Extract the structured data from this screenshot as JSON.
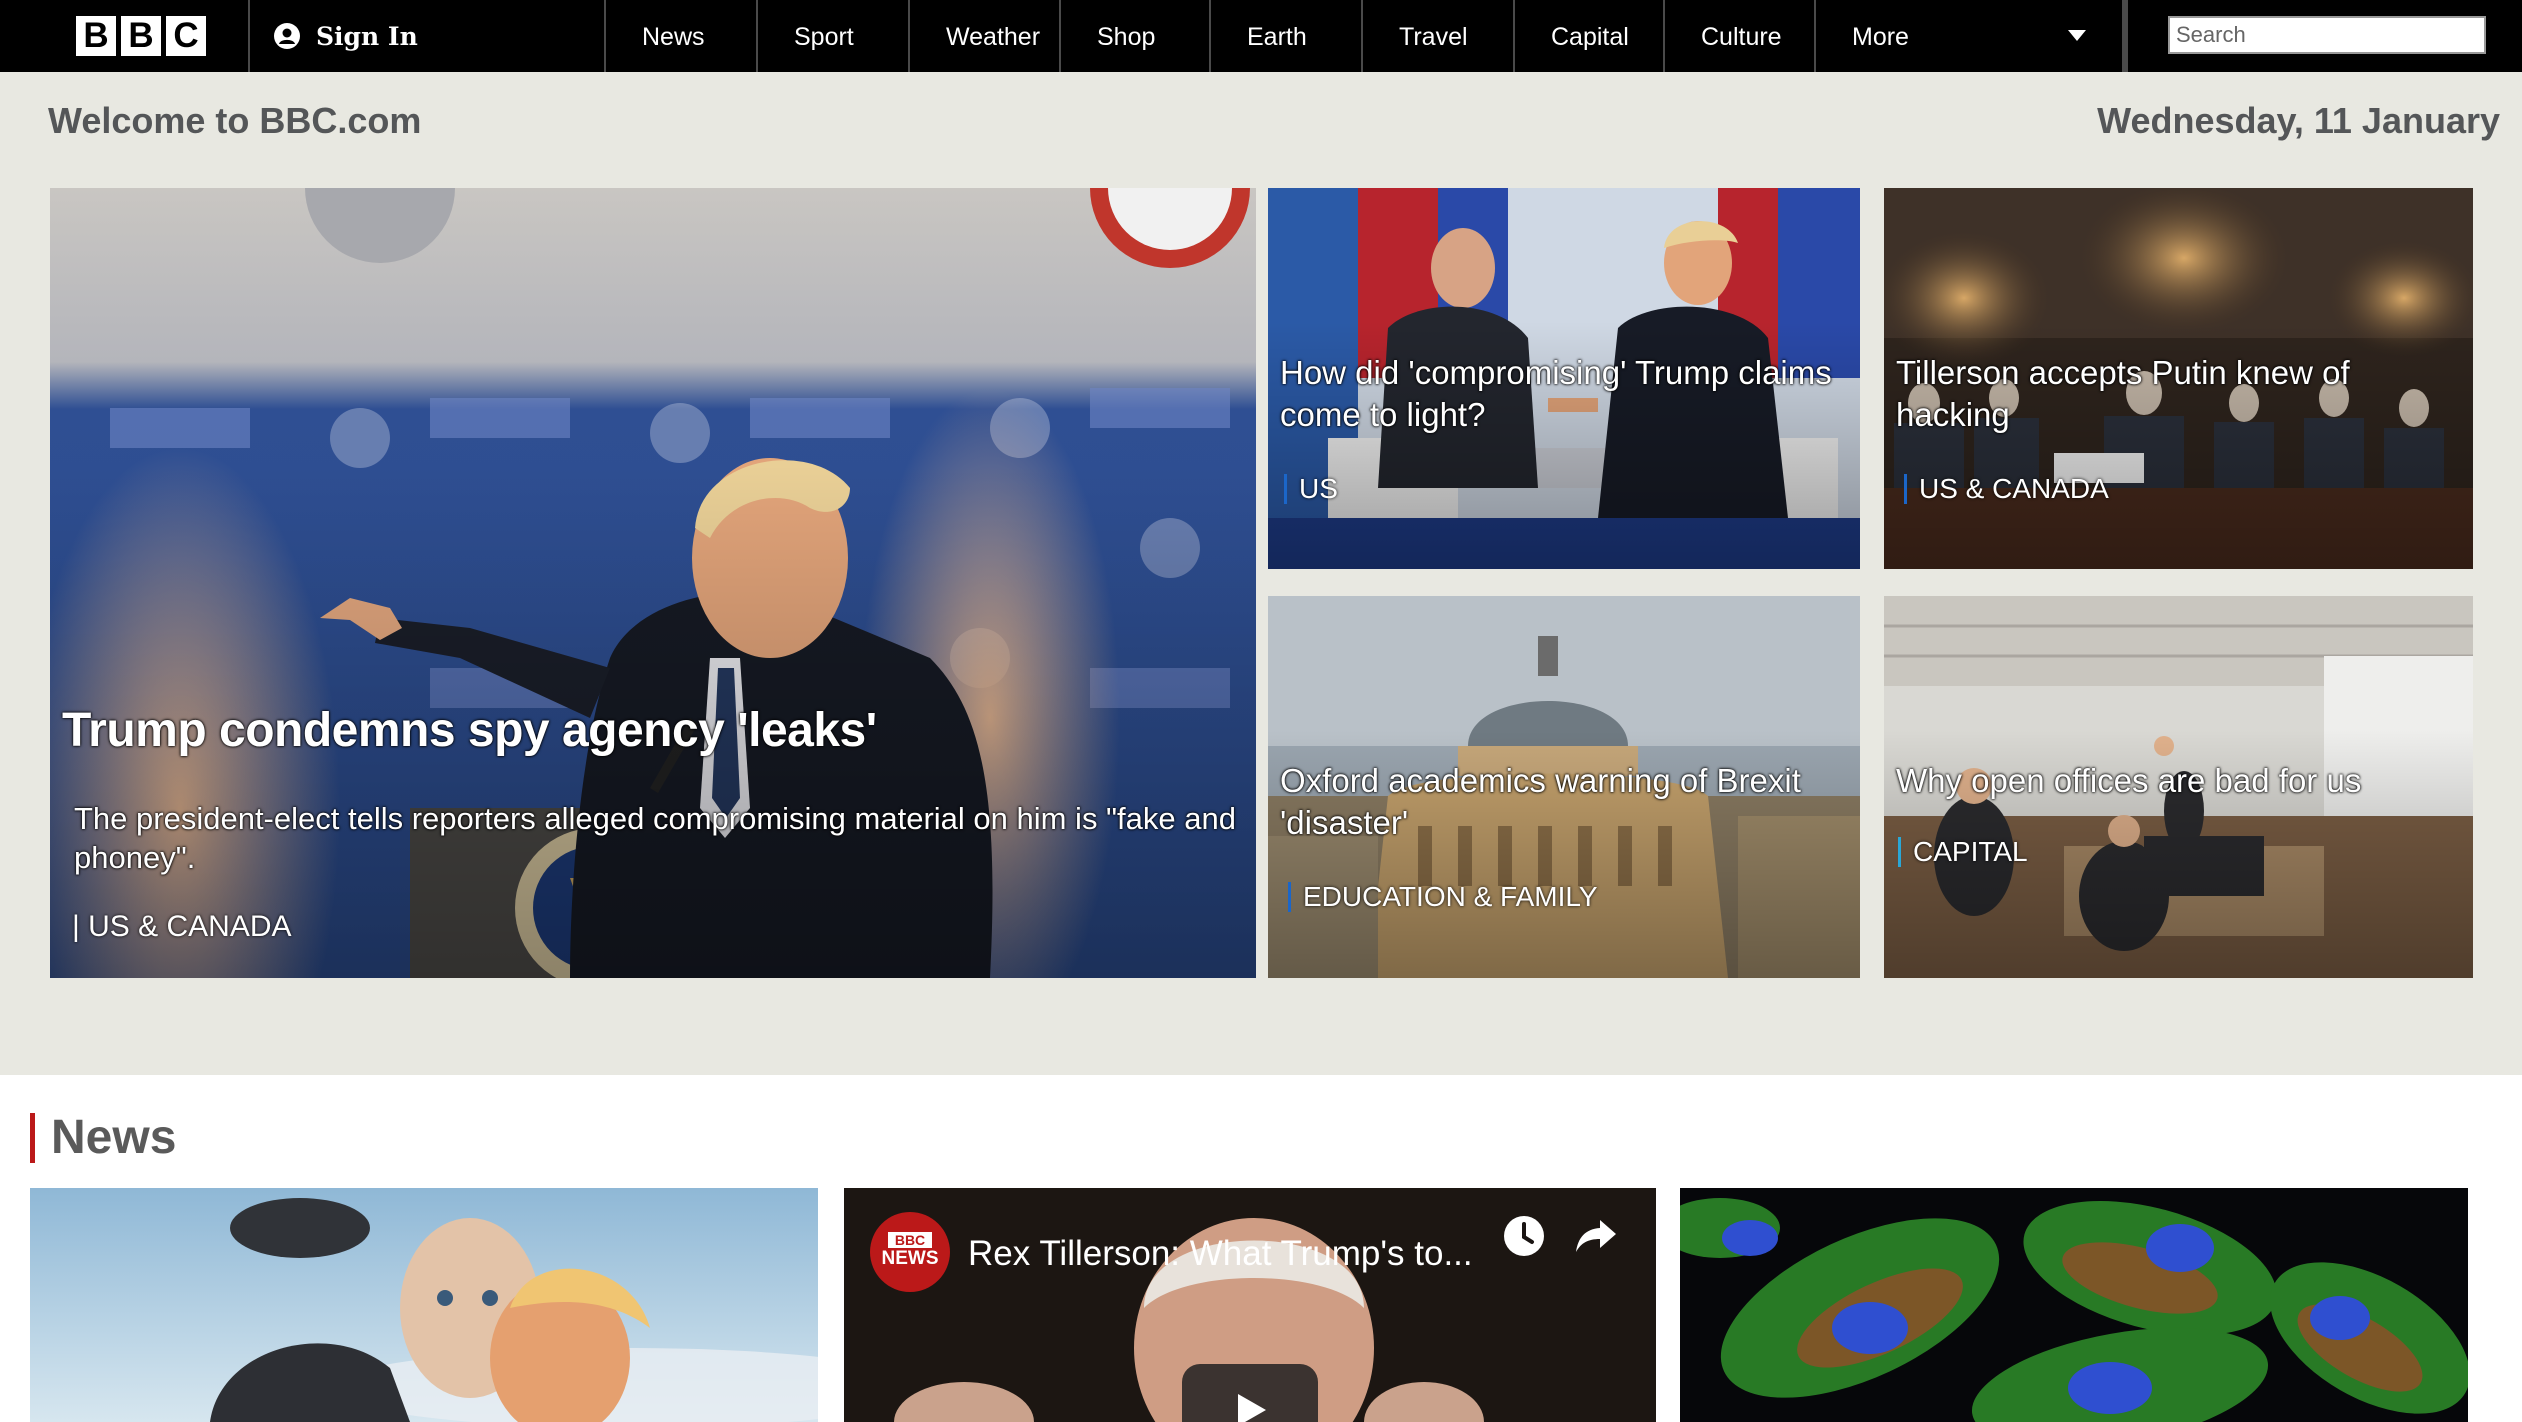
{
  "brand": {
    "letters": [
      "B",
      "B",
      "C"
    ]
  },
  "account": {
    "sign_in_label": "Sign In"
  },
  "nav": {
    "items": [
      "News",
      "Sport",
      "Weather",
      "Shop",
      "Earth",
      "Travel",
      "Capital",
      "Culture",
      "More"
    ]
  },
  "search": {
    "placeholder": "Search"
  },
  "welcome": {
    "title": "Welcome to BBC.com",
    "date": "Wednesday, 11 January"
  },
  "stories": {
    "main": {
      "headline": "Trump condemns spy agency 'leaks'",
      "summary": "The president-elect tells reporters alleged compromising material on him is \"fake and phoney\".",
      "tag": "| US & CANADA"
    },
    "s1": {
      "headline": "How did 'compromising' Trump claims come to light?",
      "tag": "US",
      "tag_color": "#1b66c9"
    },
    "s2": {
      "headline": "Tillerson accepts Putin knew of hacking",
      "tag": "US & CANADA",
      "tag_color": "#1b66c9"
    },
    "s3": {
      "headline": "Oxford academics warning of Brexit 'disaster'",
      "tag": "EDUCATION & FAMILY",
      "tag_color": "#1b66c9"
    },
    "s4": {
      "headline": "Why open offices are bad for us",
      "tag": "CAPITAL",
      "tag_color": "#2aa7d6"
    }
  },
  "news_section": {
    "title": "News",
    "video": {
      "badge_top": "BBC",
      "badge_bottom": "NEWS",
      "title": "Rex Tillerson: What Trump's to..."
    }
  },
  "colors": {
    "accent_red": "#bb1919",
    "band_bg": "#e8e8e1",
    "nav_bg": "#000000"
  }
}
